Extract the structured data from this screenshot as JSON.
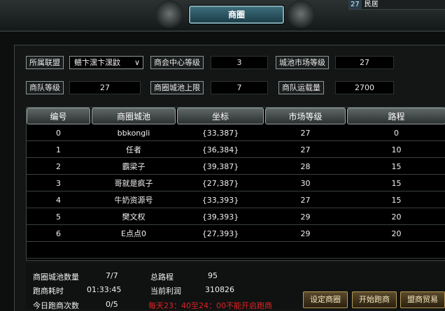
{
  "window": {
    "title": "商圈",
    "top_right_level": "27",
    "top_right_name": "民居"
  },
  "info": {
    "alliance_label": "所属联盟",
    "alliance_value": "鳂卞潶卞潶鼤",
    "chamber_level_label": "商会中心等级",
    "chamber_level_value": "3",
    "market_level_label": "城池市场等级",
    "market_level_value": "27",
    "caravan_level_label": "商队等级",
    "caravan_level_value": "27",
    "circle_limit_label": "商圈城池上限",
    "circle_limit_value": "7",
    "capacity_label": "商队运载量",
    "capacity_value": "2700"
  },
  "table": {
    "headers": [
      "编号",
      "商圈城池",
      "坐标",
      "市场等级",
      "路程"
    ],
    "rows": [
      [
        "0",
        "bbkongli",
        "{33,387}",
        "27",
        "0"
      ],
      [
        "1",
        "任者",
        "{36,384}",
        "27",
        "10"
      ],
      [
        "2",
        "霸梁子",
        "{39,387}",
        "28",
        "15"
      ],
      [
        "3",
        "哥就是疯子",
        "{27,387}",
        "30",
        "15"
      ],
      [
        "4",
        "牛奶资源号",
        "{33,393}",
        "27",
        "15"
      ],
      [
        "5",
        "樊文权",
        "{39,393}",
        "29",
        "20"
      ],
      [
        "6",
        "E点点0",
        "{27,393}",
        "29",
        "20"
      ]
    ]
  },
  "footer": {
    "city_count_label": "商圈城池数量",
    "city_count_value": "7/7",
    "total_distance_label": "总路程",
    "total_distance_value": "95",
    "run_time_label": "跑商耗时",
    "run_time_value": "01:33:45",
    "profit_label": "当前利润",
    "profit_value": "310826",
    "today_runs_label": "今日跑商次数",
    "today_runs_value": "0/5",
    "warning": "每天23：40至24：00不能开启跑商"
  },
  "buttons": {
    "set_circle": "设定商圈",
    "start_run": "开始跑商",
    "alliance_trade": "盟商贸易"
  }
}
